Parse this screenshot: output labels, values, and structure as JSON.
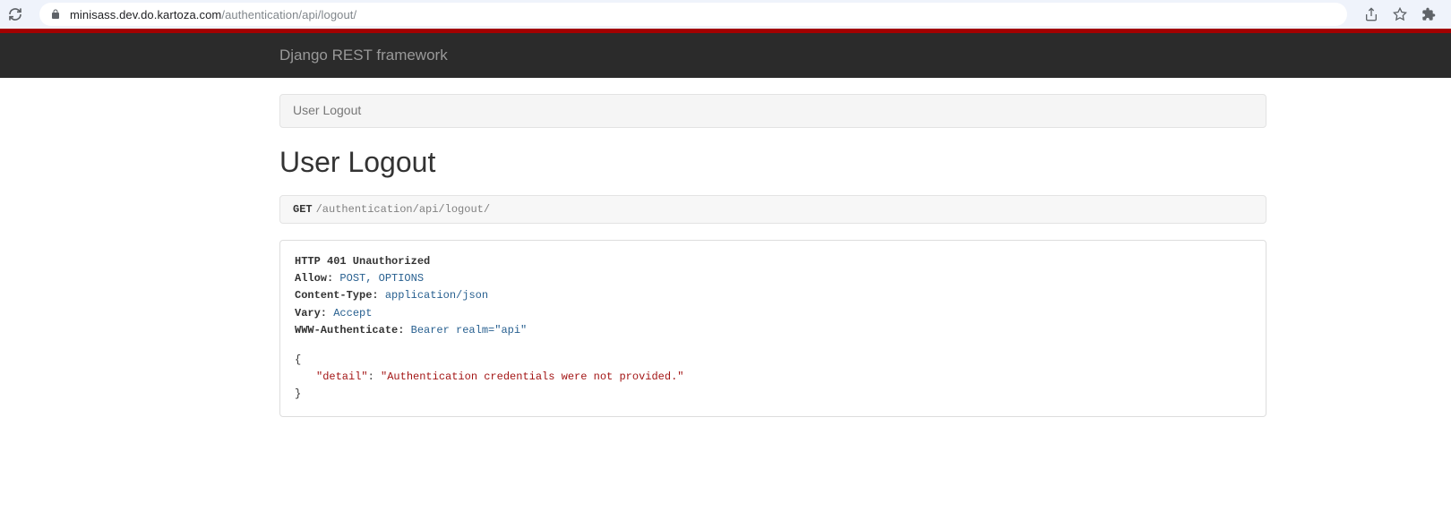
{
  "browser": {
    "url_host": "minisass.dev.do.kartoza.com",
    "url_path": "/authentication/api/logout/"
  },
  "navbar": {
    "brand": "Django REST framework"
  },
  "breadcrumb": {
    "current": "User Logout"
  },
  "page": {
    "title": "User Logout"
  },
  "request": {
    "method": "GET",
    "path": "/authentication/api/logout/"
  },
  "response": {
    "status_line": "HTTP 401 Unauthorized",
    "headers": {
      "allow_label": "Allow:",
      "allow_value": "POST, OPTIONS",
      "content_type_label": "Content-Type:",
      "content_type_value": "application/json",
      "vary_label": "Vary:",
      "vary_value": "Accept",
      "www_auth_label": "WWW-Authenticate:",
      "www_auth_value": "Bearer realm=\"api\""
    },
    "body": {
      "open_brace": "{",
      "detail_key": "\"detail\"",
      "colon": ":",
      "detail_value": "\"Authentication credentials were not provided.\"",
      "close_brace": "}"
    }
  }
}
